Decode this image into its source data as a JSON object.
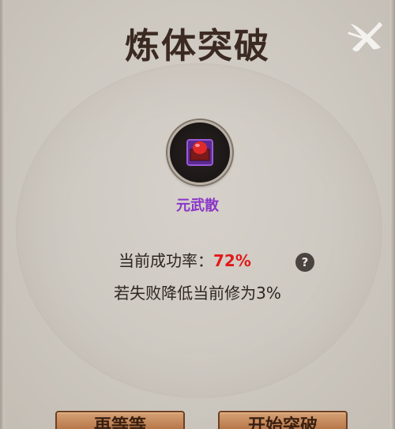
{
  "title": "炼体突破",
  "close_icon": "close-brush-x-icon",
  "item": {
    "name": "元武散",
    "icon": "red-elixir-box-icon",
    "name_color": "#8a35c9"
  },
  "success_rate": {
    "label": "当前成功率：",
    "value": "72%",
    "value_color": "#e01b1b"
  },
  "help_icon": "?",
  "failure_note": "若失败降低当前修为3%",
  "buttons": {
    "left_label": "再等等",
    "right_label": "开始突破"
  }
}
